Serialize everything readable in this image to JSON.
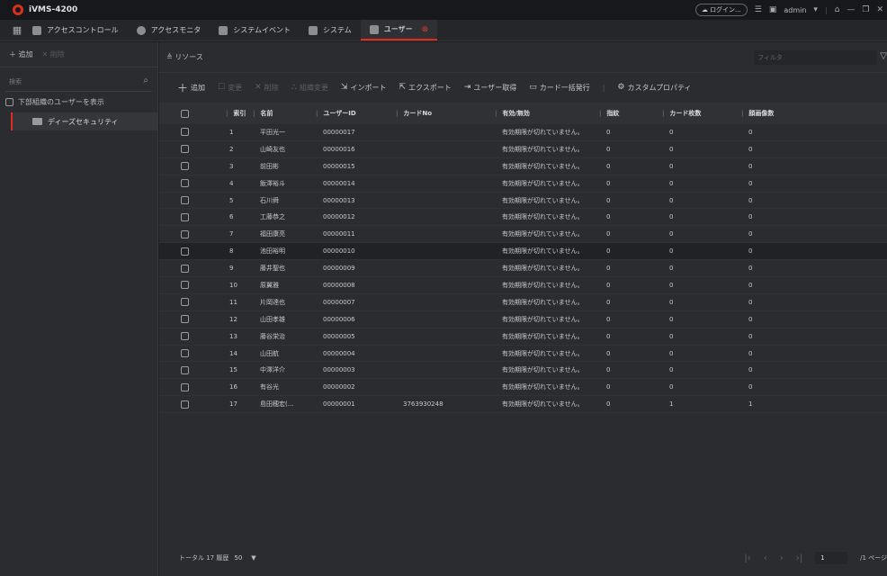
{
  "window": {
    "title": "iVMS-4200",
    "login_label": "ログイン...",
    "user": "admin"
  },
  "tabs": [
    {
      "label": "アクセスコントロール"
    },
    {
      "label": "アクセスモニタ"
    },
    {
      "label": "システムイベント"
    },
    {
      "label": "システム"
    },
    {
      "label": "ユーザー"
    }
  ],
  "left_panel": {
    "add_label": "追加",
    "delete_label": "削除",
    "search_placeholder": "検索",
    "show_sub_label": "下部組織のユーザーを表示",
    "org_node": "ディーズセキュリティ"
  },
  "main": {
    "resource_label": "リソース",
    "filter_placeholder": "フィルタ",
    "actions": {
      "add": "追加",
      "edit": "変更",
      "delete": "削除",
      "org_change": "組織変更",
      "import": "インポート",
      "export": "エクスポート",
      "get_users": "ユーザー取得",
      "batch_card": "カード一括発行",
      "custom_props": "カスタムプロパティ"
    },
    "columns": [
      "索引",
      "名前",
      "ユーザーID",
      "カードNo",
      "有効/無効",
      "指紋",
      "カード枚数",
      "顔画像数"
    ],
    "rows": [
      {
        "index": "1",
        "name": "平田光一",
        "id": "00000017",
        "card": "",
        "status": "有効期限が切れていません。",
        "fp": "0",
        "cards": "0",
        "faces": "0"
      },
      {
        "index": "2",
        "name": "山崎友也",
        "id": "00000016",
        "card": "",
        "status": "有効期限が切れていません。",
        "fp": "0",
        "cards": "0",
        "faces": "0"
      },
      {
        "index": "3",
        "name": "前田彬",
        "id": "00000015",
        "card": "",
        "status": "有効期限が切れていません。",
        "fp": "0",
        "cards": "0",
        "faces": "0"
      },
      {
        "index": "4",
        "name": "飯澤裕斗",
        "id": "00000014",
        "card": "",
        "status": "有効期限が切れていません。",
        "fp": "0",
        "cards": "0",
        "faces": "0"
      },
      {
        "index": "5",
        "name": "石川舜",
        "id": "00000013",
        "card": "",
        "status": "有効期限が切れていません。",
        "fp": "0",
        "cards": "0",
        "faces": "0"
      },
      {
        "index": "6",
        "name": "工藤恭之",
        "id": "00000012",
        "card": "",
        "status": "有効期限が切れていません。",
        "fp": "0",
        "cards": "0",
        "faces": "0"
      },
      {
        "index": "7",
        "name": "福田康亮",
        "id": "00000011",
        "card": "",
        "status": "有効期限が切れていません。",
        "fp": "0",
        "cards": "0",
        "faces": "0"
      },
      {
        "index": "8",
        "name": "池田裕明",
        "id": "00000010",
        "card": "",
        "status": "有効期限が切れていません。",
        "fp": "0",
        "cards": "0",
        "faces": "0"
      },
      {
        "index": "9",
        "name": "藤井聖也",
        "id": "00000009",
        "card": "",
        "status": "有効期限が切れていません。",
        "fp": "0",
        "cards": "0",
        "faces": "0"
      },
      {
        "index": "10",
        "name": "原翼雅",
        "id": "00000008",
        "card": "",
        "status": "有効期限が切れていません。",
        "fp": "0",
        "cards": "0",
        "faces": "0"
      },
      {
        "index": "11",
        "name": "片岡達也",
        "id": "00000007",
        "card": "",
        "status": "有効期限が切れていません。",
        "fp": "0",
        "cards": "0",
        "faces": "0"
      },
      {
        "index": "12",
        "name": "山田孝雄",
        "id": "00000006",
        "card": "",
        "status": "有効期限が切れていません。",
        "fp": "0",
        "cards": "0",
        "faces": "0"
      },
      {
        "index": "13",
        "name": "藤谷栄治",
        "id": "00000005",
        "card": "",
        "status": "有効期限が切れていません。",
        "fp": "0",
        "cards": "0",
        "faces": "0"
      },
      {
        "index": "14",
        "name": "山田航",
        "id": "00000004",
        "card": "",
        "status": "有効期限が切れていません。",
        "fp": "0",
        "cards": "0",
        "faces": "0"
      },
      {
        "index": "15",
        "name": "中澤洋介",
        "id": "00000003",
        "card": "",
        "status": "有効期限が切れていません。",
        "fp": "0",
        "cards": "0",
        "faces": "0"
      },
      {
        "index": "16",
        "name": "有谷光",
        "id": "00000002",
        "card": "",
        "status": "有効期限が切れていません。",
        "fp": "0",
        "cards": "0",
        "faces": "0"
      },
      {
        "index": "17",
        "name": "島田穂宏(...",
        "id": "00000001",
        "card": "3763930248",
        "status": "有効期限が切れていません。",
        "fp": "0",
        "cards": "1",
        "faces": "1"
      }
    ],
    "footer": {
      "total": "トータル 17 履歴",
      "page_size": "50",
      "current_page": "1",
      "page_total": "/1 ページ"
    }
  },
  "colors": {
    "accent": "#e22a1f",
    "background": "#2a2c30",
    "titlebar": "#16181b"
  }
}
